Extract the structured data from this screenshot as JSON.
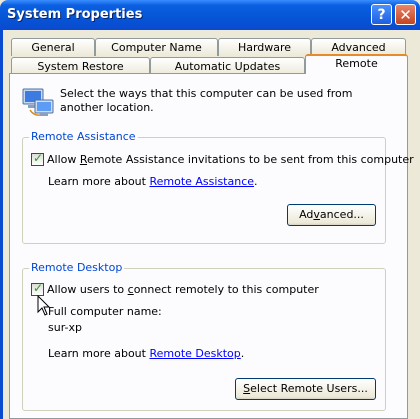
{
  "window": {
    "title": "System Properties",
    "help_glyph": "?",
    "close_glyph": "✕"
  },
  "tabs_row1": [
    "General",
    "Computer Name",
    "Hardware",
    "Advanced"
  ],
  "tabs_row2": [
    "System Restore",
    "Automatic Updates",
    "Remote"
  ],
  "selected_tab": "Remote",
  "intro_text": "Select the ways that this computer can be used from another location.",
  "remote_assistance": {
    "legend": "Remote Assistance",
    "checkbox_pre": "Allow ",
    "checkbox_key": "R",
    "checkbox_post": "emote Assistance invitations to be sent from this computer",
    "checked": true,
    "learn_prefix": "Learn more about ",
    "learn_link": "Remote Assistance",
    "learn_suffix": ".",
    "advanced_pre": "Ad",
    "advanced_key": "v",
    "advanced_post": "anced..."
  },
  "remote_desktop": {
    "legend": "Remote Desktop",
    "checkbox_pre": "Allow users to ",
    "checkbox_key": "c",
    "checkbox_post": "onnect remotely to this computer",
    "checked": true,
    "computer_name_label": "Full computer name:",
    "computer_name": "sur-xp",
    "learn_prefix": "Learn more about ",
    "learn_link": "Remote Desktop",
    "learn_suffix": ".",
    "select_pre": "",
    "select_key": "S",
    "select_post": "elect Remote Users..."
  },
  "check_glyph": "✓"
}
